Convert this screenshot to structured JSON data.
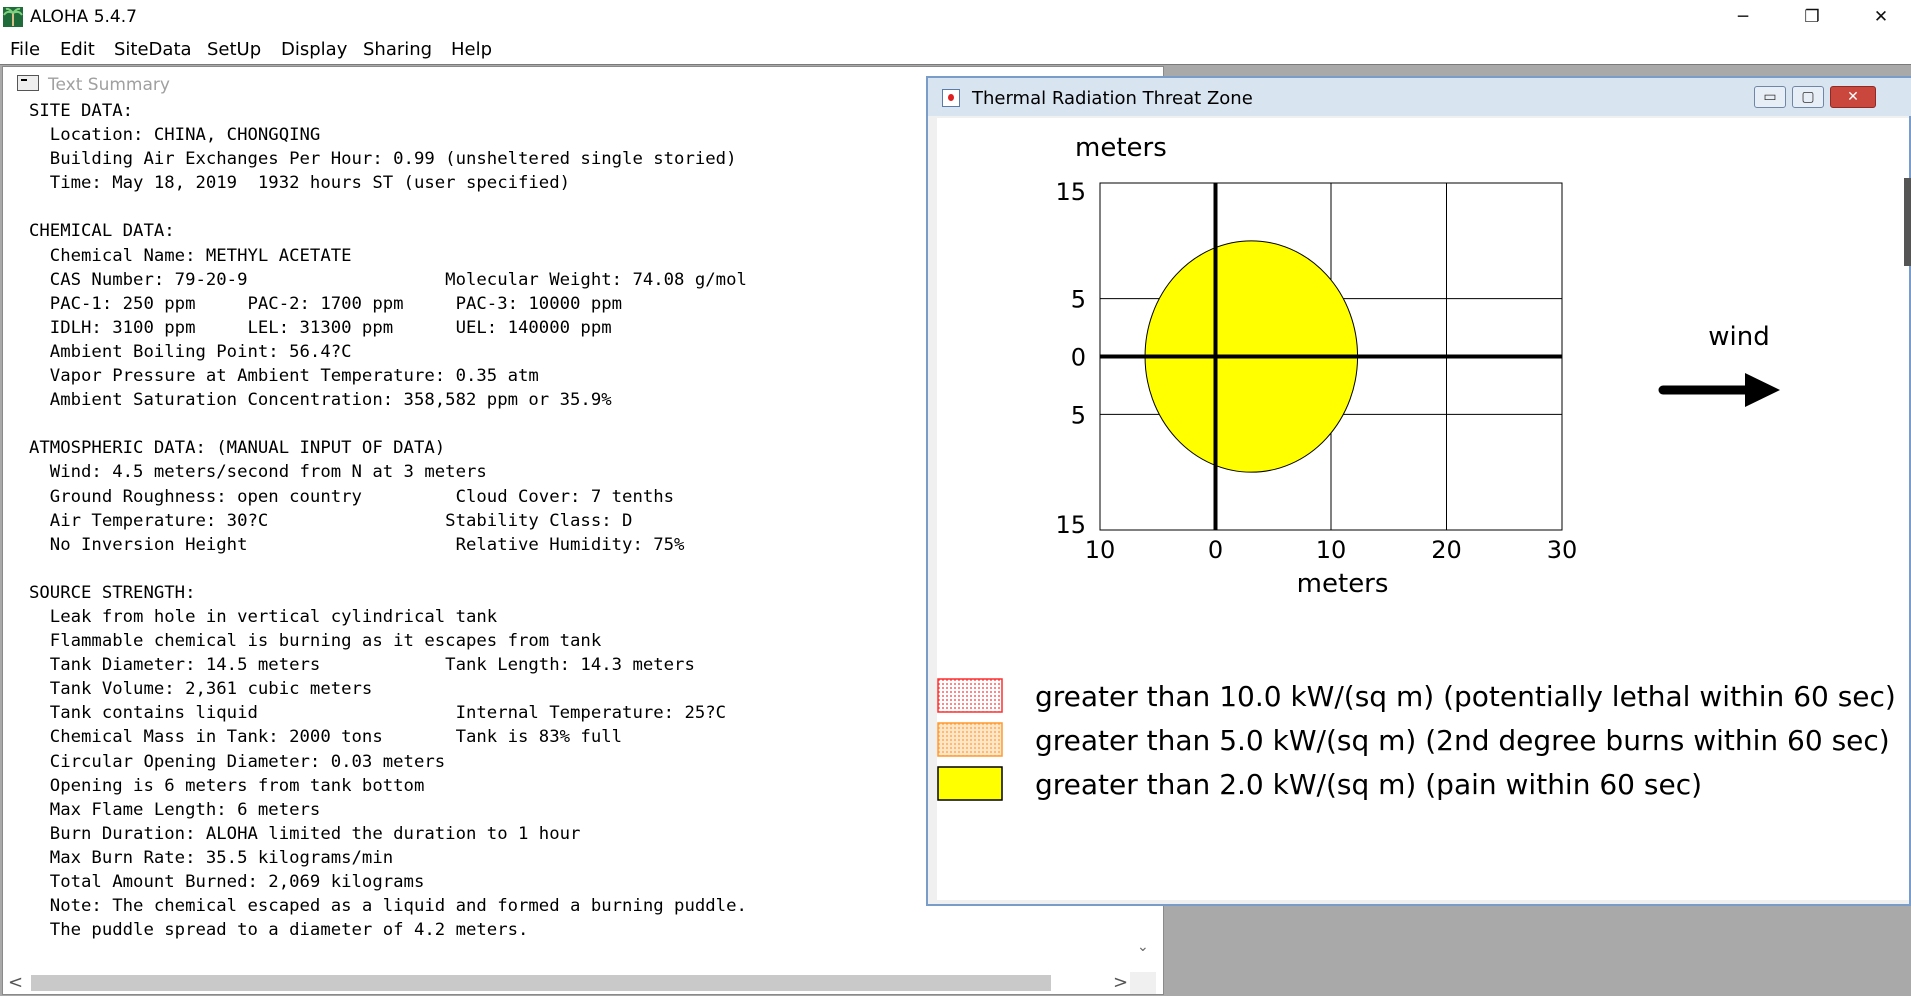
{
  "app": {
    "title": "ALOHA 5.4.7",
    "window_controls": {
      "minimize": "─",
      "restore": "❐",
      "close": "✕"
    }
  },
  "menu": [
    "File",
    "Edit",
    "SiteData",
    "SetUp",
    "Display",
    "Sharing",
    "Help"
  ],
  "text_summary": {
    "title": "Text Summary",
    "lines": [
      "SITE DATA:",
      "  Location: CHINA, CHONGQING",
      "  Building Air Exchanges Per Hour: 0.99 (unsheltered single storied)",
      "  Time: May 18, 2019  1932 hours ST (user specified)",
      "",
      "CHEMICAL DATA:",
      "  Chemical Name: METHYL ACETATE",
      "  CAS Number: 79-20-9                   Molecular Weight: 74.08 g/mol",
      "  PAC-1: 250 ppm     PAC-2: 1700 ppm     PAC-3: 10000 ppm",
      "  IDLH: 3100 ppm     LEL: 31300 ppm      UEL: 140000 ppm",
      "  Ambient Boiling Point: 56.4?C",
      "  Vapor Pressure at Ambient Temperature: 0.35 atm",
      "  Ambient Saturation Concentration: 358,582 ppm or 35.9%",
      "",
      "ATMOSPHERIC DATA: (MANUAL INPUT OF DATA)",
      "  Wind: 4.5 meters/second from N at 3 meters",
      "  Ground Roughness: open country         Cloud Cover: 7 tenths",
      "  Air Temperature: 30?C                 Stability Class: D",
      "  No Inversion Height                    Relative Humidity: 75%",
      "",
      "SOURCE STRENGTH:",
      "  Leak from hole in vertical cylindrical tank",
      "  Flammable chemical is burning as it escapes from tank",
      "  Tank Diameter: 14.5 meters            Tank Length: 14.3 meters",
      "  Tank Volume: 2,361 cubic meters",
      "  Tank contains liquid                   Internal Temperature: 25?C",
      "  Chemical Mass in Tank: 2000 tons       Tank is 83% full",
      "  Circular Opening Diameter: 0.03 meters",
      "  Opening is 6 meters from tank bottom",
      "  Max Flame Length: 6 meters",
      "  Burn Duration: ALOHA limited the duration to 1 hour",
      "  Max Burn Rate: 35.5 kilograms/min",
      "  Total Amount Burned: 2,069 kilograms",
      "  Note: The chemical escaped as a liquid and formed a burning puddle.",
      "  The puddle spread to a diameter of 4.2 meters."
    ],
    "scroll": {
      "left": "<",
      "right": ">",
      "down": "⌄"
    }
  },
  "threat_zone": {
    "title": "Thermal Radiation Threat Zone",
    "buttons": {
      "minimize": "▭",
      "maximize": "▢",
      "close": "✕"
    },
    "chart_data": {
      "type": "scatter",
      "xlabel": "meters",
      "ylabel": "meters",
      "x_ticks": [
        "10",
        "0",
        "10",
        "20",
        "30"
      ],
      "x_tick_values": [
        -10,
        0,
        10,
        20,
        30
      ],
      "y_ticks": [
        "15",
        "5",
        "0",
        "5",
        "15"
      ],
      "y_tick_values": [
        15,
        5,
        0,
        -5,
        -15
      ],
      "xlim": [
        -10,
        30
      ],
      "ylim": [
        -15,
        15
      ],
      "grid": true,
      "wind_label": "wind",
      "zones": [
        {
          "name": "greater than 10.0 kW/(sq m) (potentially lethal within 60 sec)",
          "color": "#ff0000",
          "pattern": "dotted",
          "present": false
        },
        {
          "name": "greater than 5.0 kW/(sq m) (2nd degree burns within 60 sec)",
          "color": "#ff9900",
          "pattern": "dotted",
          "present": false
        },
        {
          "name": "greater than 2.0 kW/(sq m) (pain within 60 sec)",
          "color": "#ffff00",
          "pattern": "solid",
          "present": true,
          "shape": {
            "center_x": 3.1,
            "center_y": 0,
            "radius_x": 9.2,
            "radius_y": 10
          }
        }
      ]
    }
  }
}
